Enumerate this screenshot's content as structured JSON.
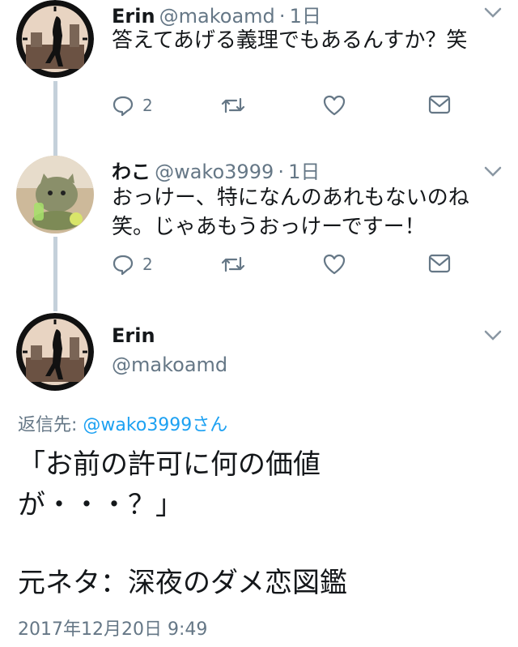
{
  "tweets": [
    {
      "name": "Erin",
      "handle": "@makoamd",
      "sep": "·",
      "time": "1日",
      "lines": [
        "答えてあげる義理でもあるんすか？笑"
      ],
      "replies": "2"
    },
    {
      "name": "わこ",
      "handle": "@wako3999",
      "sep": "·",
      "time": "1日",
      "lines": [
        "おっけー、特になんのあれもないのね",
        "笑。じゃあもうおっけーですー！"
      ],
      "replies": "2"
    }
  ],
  "main": {
    "name": "Erin",
    "handle": "@makoamd",
    "reply_to_label": "返信先:",
    "reply_to_handle": "@wako3999さん",
    "body_lines": [
      "「お前の許可に何の価値",
      "が・・・？」",
      "",
      "元ネタ：深夜のダメ恋図鑑"
    ],
    "timestamp": "2017年12月20日 9:49"
  },
  "colors": {
    "link": "#1da1f2",
    "muted": "#657786",
    "thread_line": "#c4d0da"
  },
  "icons": [
    "reply-icon",
    "retweet-icon",
    "like-icon",
    "dm-icon",
    "chevron-down-icon"
  ]
}
